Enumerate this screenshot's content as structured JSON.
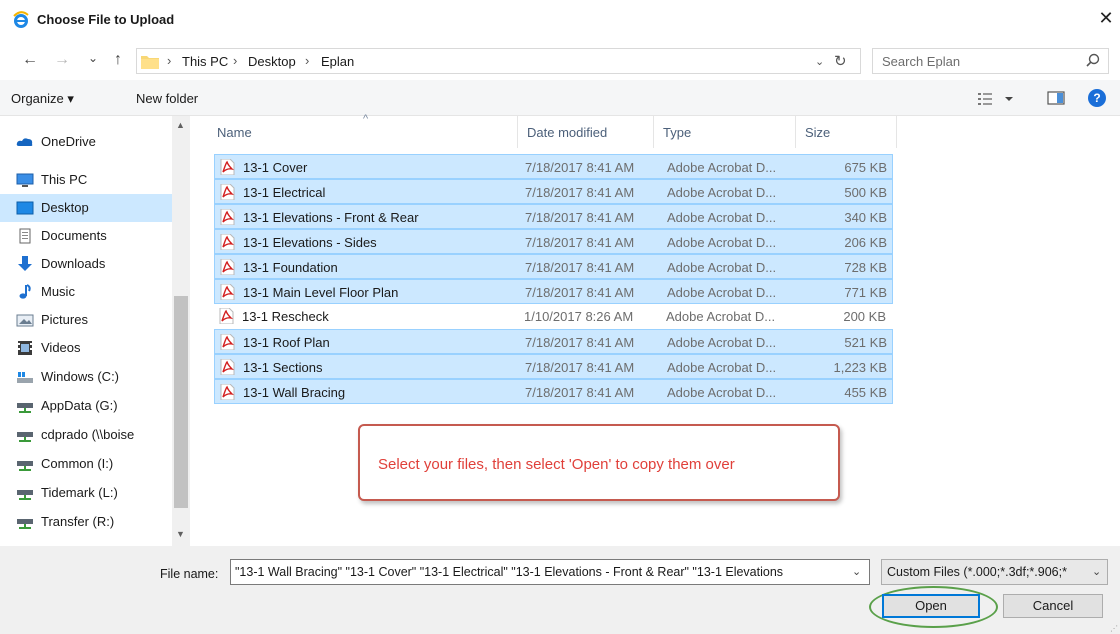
{
  "window": {
    "title": "Choose File to Upload",
    "close_glyph": "✕"
  },
  "nav": {
    "back_glyph": "←",
    "forward_glyph": "→",
    "recent_glyph": "⌄",
    "up_glyph": "↑",
    "breadcrumb": [
      "This PC",
      "Desktop",
      "Eplan"
    ],
    "separator": "›",
    "dropdown_glyph": "⌄",
    "refresh_glyph": "↻"
  },
  "search": {
    "placeholder": "Search Eplan"
  },
  "toolbar": {
    "organize_label": "Organize ▾",
    "new_folder_label": "New folder",
    "help_label": "?"
  },
  "sidebar": {
    "items": [
      {
        "label": "OneDrive",
        "icon": "cloud-icon"
      },
      {
        "label": "This PC",
        "icon": "monitor-icon"
      },
      {
        "label": "Desktop",
        "icon": "desktop-icon"
      },
      {
        "label": "Documents",
        "icon": "document-icon"
      },
      {
        "label": "Downloads",
        "icon": "download-icon"
      },
      {
        "label": "Music",
        "icon": "music-icon"
      },
      {
        "label": "Pictures",
        "icon": "pictures-icon"
      },
      {
        "label": "Videos",
        "icon": "videos-icon"
      },
      {
        "label": "Windows (C:)",
        "icon": "drive-icon"
      },
      {
        "label": "AppData (G:)",
        "icon": "network-drive-icon"
      },
      {
        "label": "cdprado (\\\\boise",
        "icon": "network-drive-icon"
      },
      {
        "label": "Common (I:)",
        "icon": "network-drive-icon"
      },
      {
        "label": "Tidemark (L:)",
        "icon": "network-drive-icon"
      },
      {
        "label": "Transfer (R:)",
        "icon": "network-drive-icon"
      }
    ],
    "selected": "Desktop"
  },
  "columns": {
    "name": "Name",
    "date": "Date modified",
    "type": "Type",
    "size": "Size",
    "sort_glyph": "^"
  },
  "files": [
    {
      "name": "13-1 Cover",
      "date": "7/18/2017 8:41 AM",
      "type": "Adobe Acrobat D...",
      "size": "675 KB",
      "selected": true
    },
    {
      "name": "13-1 Electrical",
      "date": "7/18/2017 8:41 AM",
      "type": "Adobe Acrobat D...",
      "size": "500 KB",
      "selected": true
    },
    {
      "name": "13-1 Elevations - Front & Rear",
      "date": "7/18/2017 8:41 AM",
      "type": "Adobe Acrobat D...",
      "size": "340 KB",
      "selected": true
    },
    {
      "name": "13-1 Elevations - Sides",
      "date": "7/18/2017 8:41 AM",
      "type": "Adobe Acrobat D...",
      "size": "206 KB",
      "selected": true
    },
    {
      "name": "13-1 Foundation",
      "date": "7/18/2017 8:41 AM",
      "type": "Adobe Acrobat D...",
      "size": "728 KB",
      "selected": true
    },
    {
      "name": "13-1 Main Level Floor Plan",
      "date": "7/18/2017 8:41 AM",
      "type": "Adobe Acrobat D...",
      "size": "771 KB",
      "selected": true
    },
    {
      "name": "13-1 Rescheck",
      "date": "1/10/2017 8:26 AM",
      "type": "Adobe Acrobat D...",
      "size": "200 KB",
      "selected": false
    },
    {
      "name": "13-1 Roof Plan",
      "date": "7/18/2017 8:41 AM",
      "type": "Adobe Acrobat D...",
      "size": "521 KB",
      "selected": true
    },
    {
      "name": "13-1 Sections",
      "date": "7/18/2017 8:41 AM",
      "type": "Adobe Acrobat D...",
      "size": "1,223 KB",
      "selected": true
    },
    {
      "name": "13-1 Wall Bracing",
      "date": "7/18/2017 8:41 AM",
      "type": "Adobe Acrobat D...",
      "size": "455 KB",
      "selected": true
    }
  ],
  "callout": {
    "text": "Select your files, then select 'Open' to copy them over"
  },
  "footer": {
    "filename_label": "File name:",
    "filename_value": "\"13-1 Wall Bracing\" \"13-1 Cover\" \"13-1 Electrical\" \"13-1 Elevations - Front & Rear\" \"13-1 Elevations",
    "filter_value": "Custom Files (*.000;*.3df;*.906;*",
    "dropdown_glyph": "⌄",
    "open_label": "Open",
    "cancel_label": "Cancel"
  },
  "colors": {
    "selection_bg": "#cce8ff",
    "selection_border": "#99d1ff",
    "accent": "#0078d7",
    "callout_text": "#e0403a",
    "highlight_ring": "#5aa04a"
  }
}
